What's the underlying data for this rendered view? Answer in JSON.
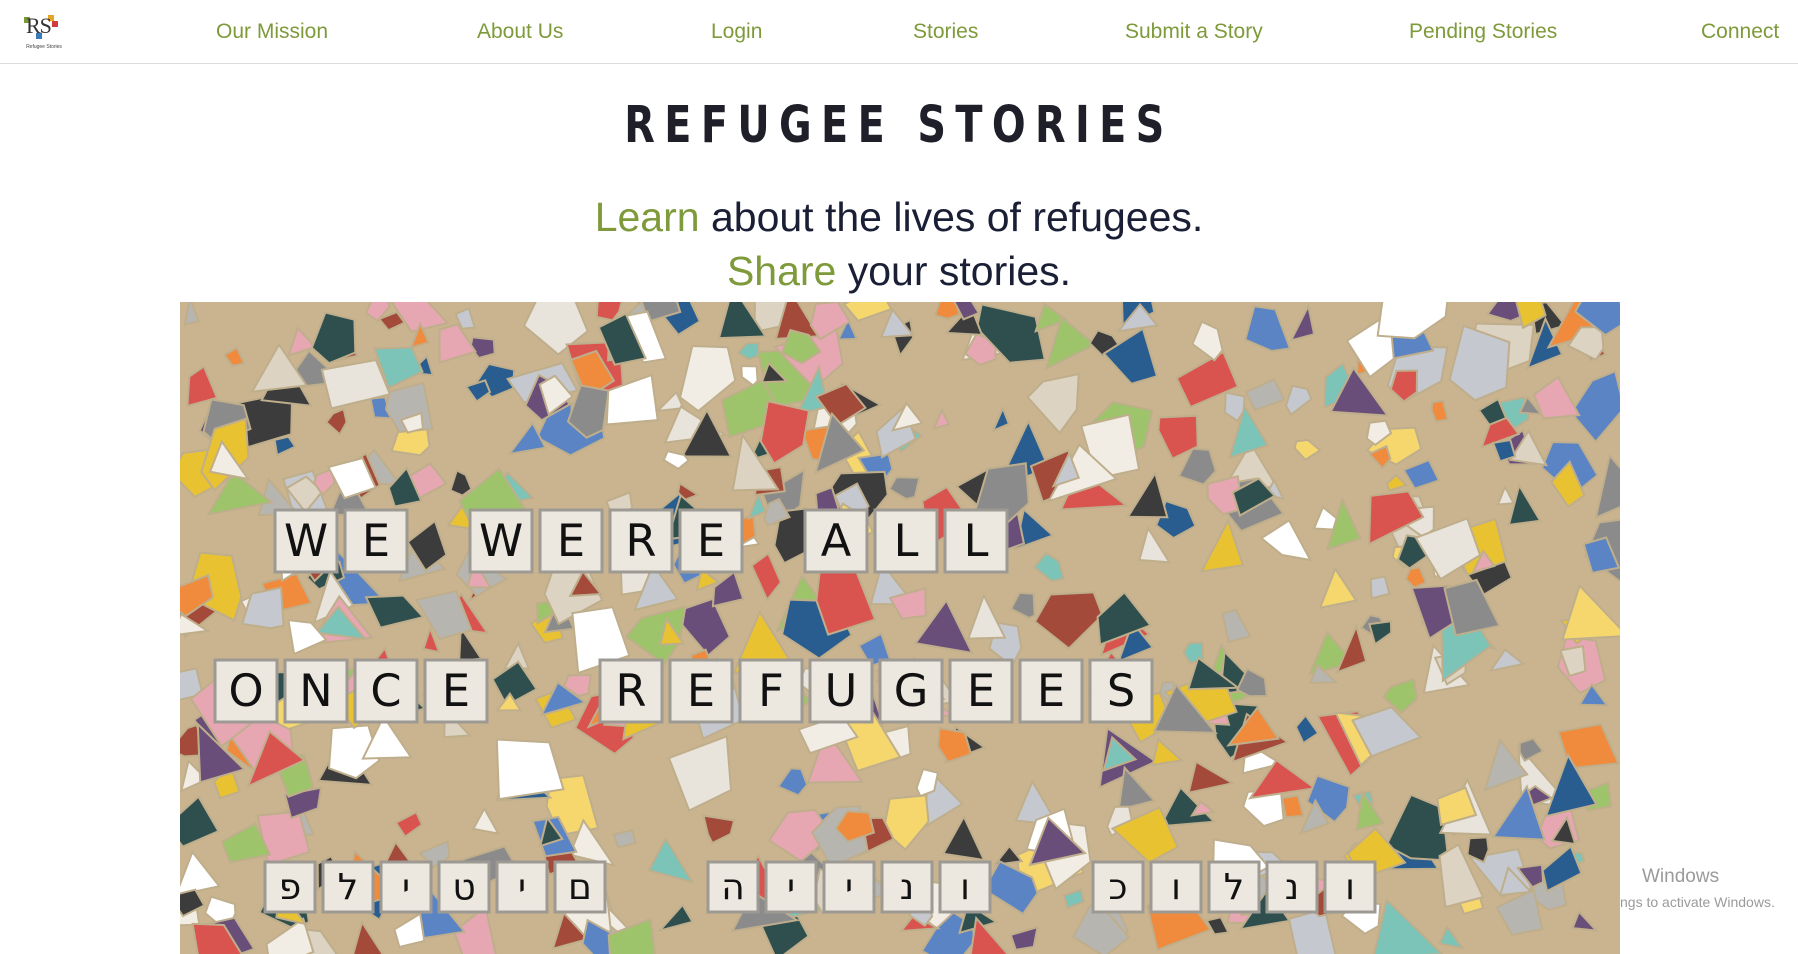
{
  "logo": {
    "letters": "RS",
    "caption": "Refugee Stories"
  },
  "nav": {
    "items": [
      "Our Mission",
      "About Us",
      "Login",
      "Stories",
      "Submit a Story",
      "Pending Stories",
      "Connect"
    ]
  },
  "title": "REFUGEE STORIES",
  "tagline": {
    "line1_accent": "Learn",
    "line1_rest": " about the lives of refugees.",
    "line2_accent": "Share",
    "line2_rest": " your stories."
  },
  "hero": {
    "row1": [
      "WE",
      "WERE",
      "ALL"
    ],
    "row2": [
      "ONCE",
      "REFUGEES"
    ],
    "row3": [
      "פליטים",
      "היינו",
      "כולנו"
    ]
  },
  "watermark": {
    "line1": "Windows",
    "line2": "ngs to activate Windows."
  },
  "colors": {
    "accent": "#7e9a3a",
    "text": "#1a1f36"
  }
}
